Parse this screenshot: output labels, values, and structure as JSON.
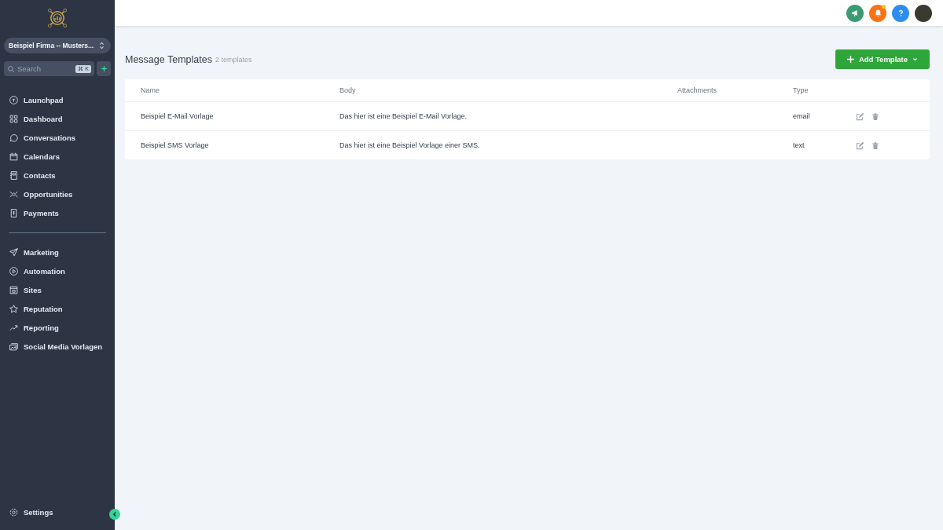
{
  "sidebar": {
    "account": "Beispiel Firma -- Musters...",
    "search": {
      "placeholder": "Search",
      "shortcut": "⌘ K"
    },
    "groups": [
      [
        {
          "label": "Launchpad",
          "selected": false
        },
        {
          "label": "Dashboard",
          "selected": false
        },
        {
          "label": "Conversations",
          "selected": false
        },
        {
          "label": "Calendars",
          "selected": false
        },
        {
          "label": "Contacts",
          "selected": false
        },
        {
          "label": "Opportunities",
          "selected": false
        },
        {
          "label": "Payments",
          "selected": false
        }
      ],
      [
        {
          "label": "Marketing",
          "selected": false
        },
        {
          "label": "Automation",
          "selected": false
        },
        {
          "label": "Sites",
          "selected": false
        },
        {
          "label": "Reputation",
          "selected": false
        },
        {
          "label": "Reporting",
          "selected": false
        },
        {
          "label": "Social Media Vorlagen",
          "selected": false
        }
      ]
    ],
    "settings": "Settings"
  },
  "header": {
    "notification_dot": true
  },
  "page": {
    "title": "Message Templates",
    "count": "2 templates",
    "add_button": "Add Template"
  },
  "table": {
    "columns": [
      "Name",
      "Body",
      "Attachments",
      "Type"
    ],
    "rows": [
      {
        "name": "Beispiel E-Mail Vorlage",
        "body": "Das hier ist eine Beispiel E-Mail Vorlage.",
        "type": "email"
      },
      {
        "name": "Beispiel SMS Vorlage",
        "body": "Das hier ist eine Beispiel Vorlage einer SMS.",
        "type": "text"
      }
    ]
  }
}
